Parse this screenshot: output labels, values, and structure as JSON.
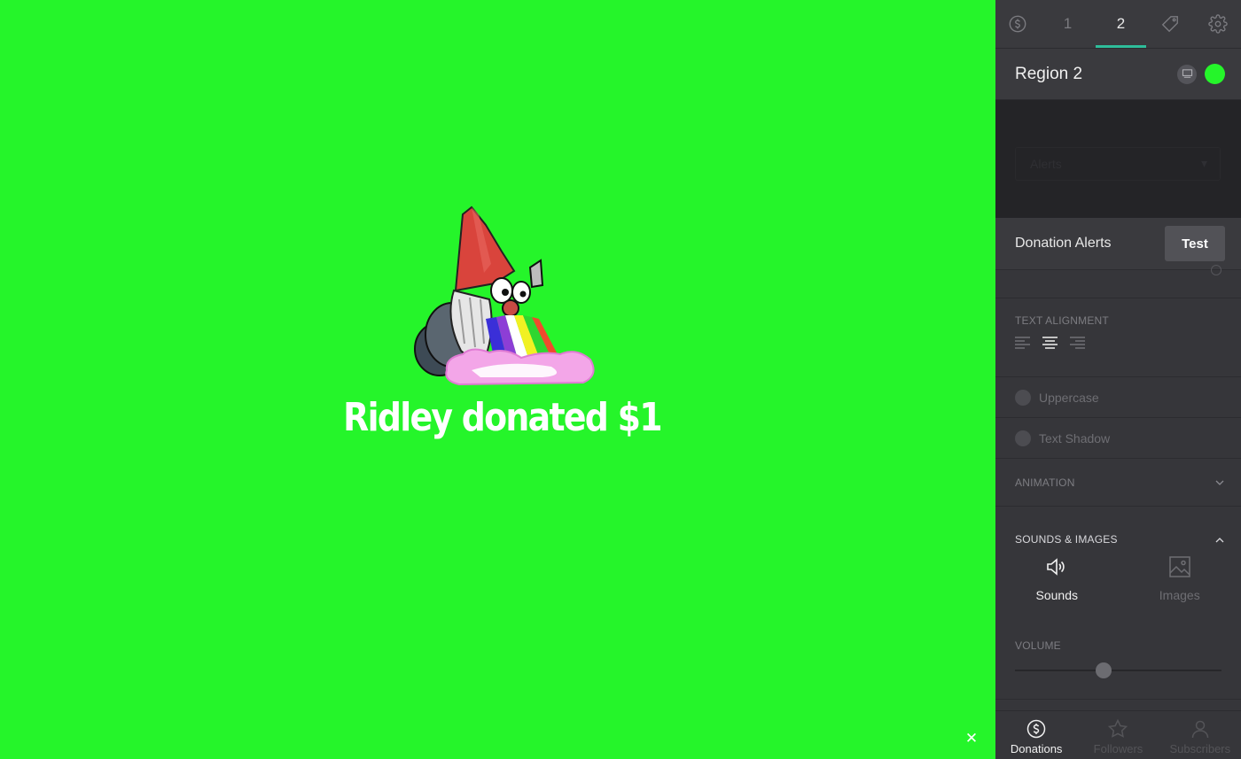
{
  "preview": {
    "background_color": "#25f52a",
    "alert_text": "Ridley donated $1",
    "close_icon": "close-icon",
    "close_symbol": "✕"
  },
  "panel": {
    "tabs": [
      {
        "icon": "dollar-circle-icon",
        "label": ""
      },
      {
        "label": "1"
      },
      {
        "label": "2",
        "active": true
      },
      {
        "icon": "tag-icon",
        "label": ""
      },
      {
        "icon": "gear-icon",
        "label": ""
      }
    ],
    "region": {
      "title": "Region 2",
      "status_color": "#25f52a"
    },
    "ghost_select": {
      "value": "Alerts"
    },
    "donation_alerts": {
      "label": "Donation Alerts",
      "test_label": "Test"
    },
    "text_alignment": {
      "caption": "TEXT ALIGNMENT",
      "options": [
        "left",
        "center",
        "right"
      ],
      "selected": "center"
    },
    "toggles": {
      "uppercase": "Uppercase",
      "text_shadow": "Text Shadow"
    },
    "animation": {
      "caption": "ANIMATION"
    },
    "sounds_images": {
      "caption": "SOUNDS & IMAGES",
      "sounds_label": "Sounds",
      "images_label": "Images",
      "selected": "Sounds"
    },
    "volume": {
      "caption": "VOLUME",
      "value_fraction": 0.43
    },
    "bottom_nav": {
      "donations": "Donations",
      "followers": "Followers",
      "subscribers": "Subscribers",
      "selected": "Donations"
    }
  }
}
